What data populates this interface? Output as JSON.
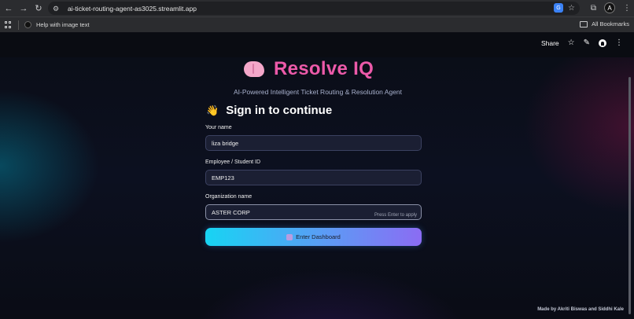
{
  "browser": {
    "url": "ai-ticket-routing-agent-as3025.streamlit.app",
    "profile_initial": "A",
    "bookmarks": [
      {
        "label": "Help with image text"
      }
    ],
    "all_bookmarks_label": "All Bookmarks"
  },
  "app_header": {
    "share_label": "Share"
  },
  "hero": {
    "title": "Resolve IQ",
    "subtitle": "AI-Powered Intelligent Ticket Routing & Resolution Agent"
  },
  "signin": {
    "emoji": "👋",
    "title": "Sign in to continue",
    "fields": [
      {
        "label": "Your name",
        "value": "liza bridge"
      },
      {
        "label": "Employee / Student ID",
        "value": "EMP123"
      },
      {
        "label": "Organization name",
        "value": "ASTER CORP",
        "hint": "Press Enter to apply"
      }
    ],
    "submit_label": "Enter Dashboard"
  },
  "footer": {
    "credit": "Made by Akriti Biswas and Siddhi Kale"
  }
}
